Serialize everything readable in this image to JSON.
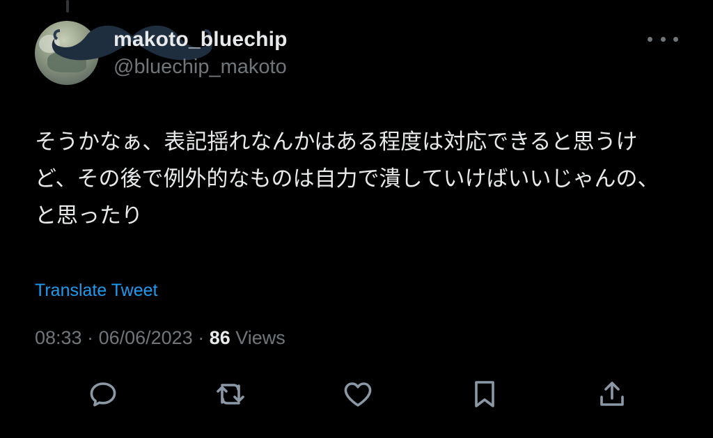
{
  "author": {
    "display_name": "makoto_bluechip",
    "handle": "@bluechip_makoto"
  },
  "tweet": {
    "text": "そうかなぁ、表記揺れなんかはある程度は対応できると思うけど、その後で例外的なものは自力で潰していけばいいじゃんの、と思ったり",
    "translate_label": "Translate Tweet",
    "time": "08:33",
    "separator": " · ",
    "date": "06/06/2023",
    "views_count": "86",
    "views_label": " Views"
  },
  "actions": [
    {
      "name": "reply",
      "icon": "reply-icon"
    },
    {
      "name": "retweet",
      "icon": "retweet-icon"
    },
    {
      "name": "like",
      "icon": "heart-icon"
    },
    {
      "name": "bookmark",
      "icon": "bookmark-icon"
    },
    {
      "name": "share",
      "icon": "share-icon"
    }
  ],
  "colors": {
    "background": "#000000",
    "text_primary": "#e7e9ea",
    "text_secondary": "#71767b",
    "link": "#1d9bf0",
    "icon": "#8b98a5"
  }
}
